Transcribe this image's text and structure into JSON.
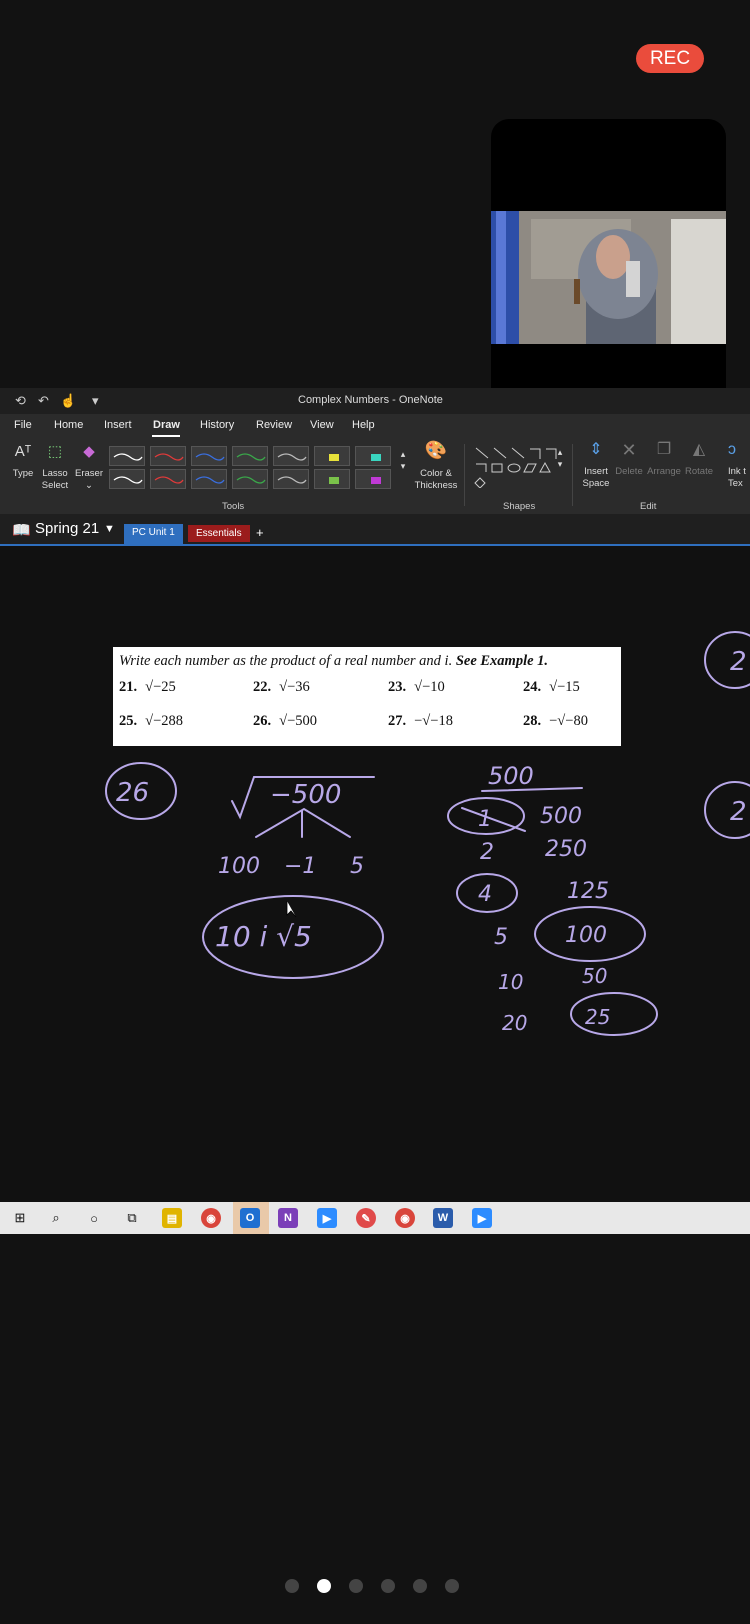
{
  "recording": {
    "label": "REC"
  },
  "window": {
    "title": "Complex Numbers - OneNote"
  },
  "menu": {
    "items": [
      "File",
      "Home",
      "Insert",
      "Draw",
      "History",
      "Review",
      "View",
      "Help"
    ],
    "active": "Draw"
  },
  "ribbon": {
    "tools": {
      "type": "Type",
      "lasso_line1": "Lasso",
      "lasso_line2": "Select",
      "eraser": "Eraser"
    },
    "color_thickness_line1": "Color &",
    "color_thickness_line2": "Thickness",
    "insert_space_line1": "Insert",
    "insert_space_line2": "Space",
    "delete": "Delete",
    "arrange": "Arrange",
    "rotate": "Rotate",
    "ink_line1": "Ink t",
    "ink_line2": "Tex",
    "groups": {
      "tools": "Tools",
      "shapes": "Shapes",
      "edit": "Edit"
    },
    "pen_colors": [
      "#ffffff",
      "#e03a3a",
      "#3a6fe0",
      "#3aa84a",
      "#cccccc",
      "#e8e23a",
      "#3ad6c0"
    ],
    "pen_colors_row2": [
      "#ffffff",
      "#e03a3a",
      "#3a6fe0",
      "#3aa84a",
      "#cccccc",
      "#7ac24a",
      "#c03ad6"
    ]
  },
  "notebook": {
    "name": "Spring 21",
    "tabs": [
      {
        "label": "PC Unit 1",
        "color": "#2f6fbf"
      },
      {
        "label": "Essentials",
        "color": "#9b1c1c"
      },
      {
        "label": "+",
        "color": "#1f1f1f"
      }
    ]
  },
  "problem": {
    "instruction": "Write each number as the product of a real number and i.",
    "see": "See Example 1.",
    "items": [
      {
        "num": "21.",
        "expr": "√−25"
      },
      {
        "num": "22.",
        "expr": "√−36"
      },
      {
        "num": "23.",
        "expr": "√−10"
      },
      {
        "num": "24.",
        "expr": "√−15"
      },
      {
        "num": "25.",
        "expr": "√−288"
      },
      {
        "num": "26.",
        "expr": "√−500"
      },
      {
        "num": "27.",
        "expr": "−√−18"
      },
      {
        "num": "28.",
        "expr": "−√−80"
      }
    ]
  },
  "ink": {
    "circled_problem": "26",
    "radical": "−500",
    "factors": [
      "100",
      "−1",
      "5"
    ],
    "answer": "10 i √5",
    "factor_table": {
      "top": "500",
      "pairs": [
        [
          "1",
          "500"
        ],
        [
          "2",
          "250"
        ],
        [
          "4",
          "125"
        ],
        [
          "5",
          "100"
        ],
        [
          "10",
          "50"
        ],
        [
          "20",
          "25"
        ]
      ]
    },
    "margin_right": [
      "2",
      "2"
    ]
  },
  "taskbar": {
    "icons": [
      "windows-icon",
      "search-icon",
      "cortana-icon",
      "task-view-icon",
      "file-explorer-icon",
      "chrome-icon",
      "outlook-icon",
      "onenote-icon",
      "zoom-icon",
      "paint-icon",
      "chrome-icon-2",
      "word-icon",
      "zoom-icon-2"
    ]
  },
  "pager": {
    "count": 6,
    "active": 1
  }
}
